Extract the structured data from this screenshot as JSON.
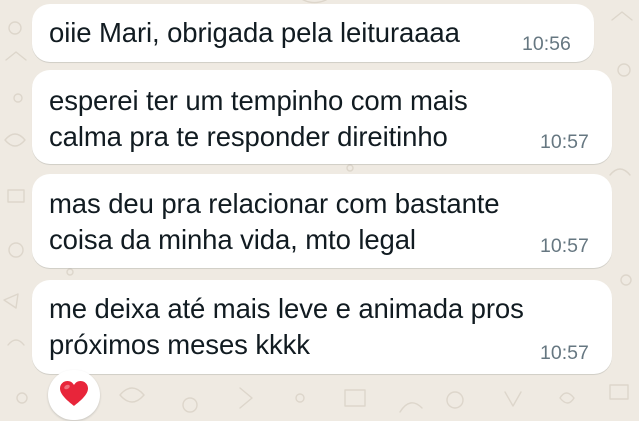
{
  "chat": {
    "messages": [
      {
        "lines": [
          "oiie Mari, obrigada pela leituraaaa"
        ],
        "time": "10:56"
      },
      {
        "lines": [
          "esperei ter um tempinho com mais",
          "calma pra te responder direitinho"
        ],
        "time": "10:57"
      },
      {
        "lines": [
          "mas deu pra relacionar com bastante",
          "coisa da minha vida, mto legal"
        ],
        "time": "10:57"
      },
      {
        "lines": [
          "me deixa até mais leve e animada pros",
          "próximos meses kkkk"
        ],
        "time": "10:57"
      }
    ],
    "reaction": {
      "icon": "red-heart-icon",
      "color": "#e8253a"
    }
  },
  "colors": {
    "wallpaper": "#efeae2",
    "bubble": "#ffffff",
    "message_text": "#111b21",
    "timestamp": "#667781"
  }
}
